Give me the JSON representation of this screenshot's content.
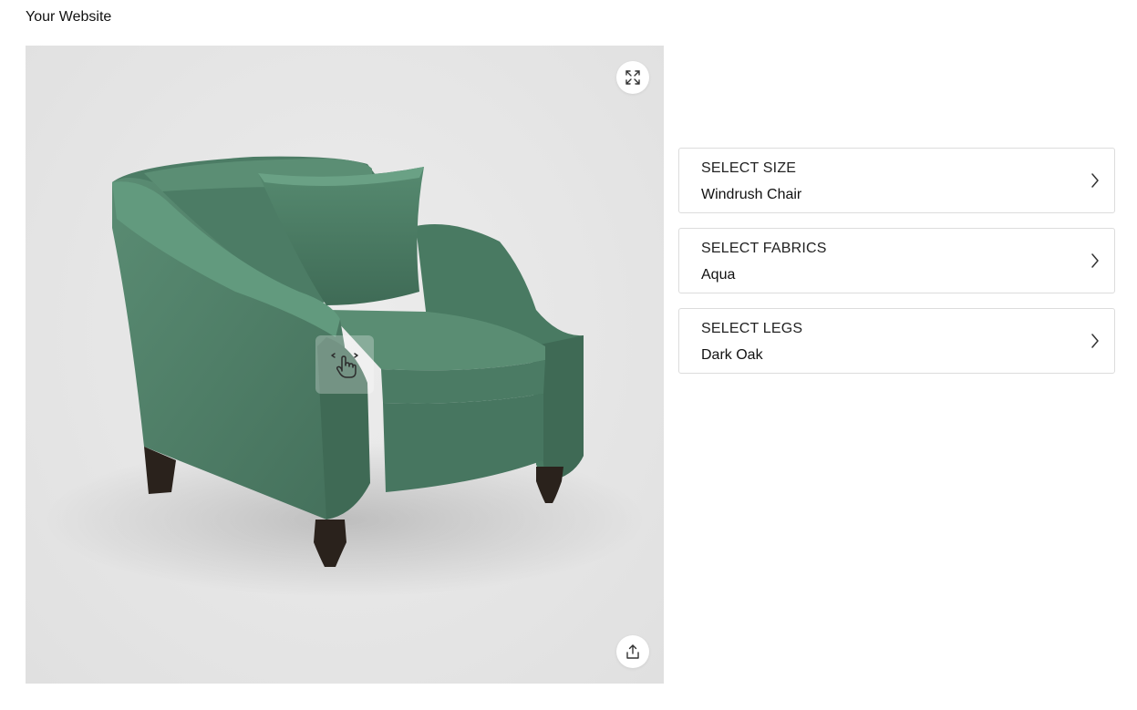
{
  "site": {
    "title": "Your Website"
  },
  "viewer": {
    "background": "#e5e5e5",
    "fabric_color": "#4f8068",
    "legs_color": "#2a221c",
    "icons": {
      "fullscreen": "expand-arrows-icon",
      "share": "share-upload-icon",
      "drag_hint": "hand-drag-rotate-icon"
    }
  },
  "options": [
    {
      "heading": "SELECT SIZE",
      "value": "Windrush Chair",
      "icon": "chevron-right-icon"
    },
    {
      "heading": "SELECT FABRICS",
      "value": "Aqua",
      "icon": "chevron-right-icon"
    },
    {
      "heading": "SELECT LEGS",
      "value": "Dark Oak",
      "icon": "chevron-right-icon"
    }
  ]
}
